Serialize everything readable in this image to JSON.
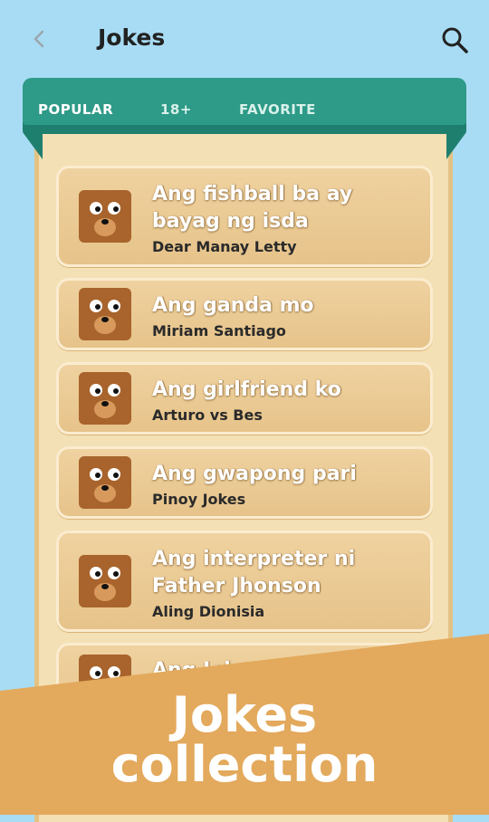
{
  "app_bar": {
    "title": "Jokes",
    "back_icon": "chevron-left-icon",
    "search_icon": "search-icon"
  },
  "tabs": [
    {
      "label": "POPULAR",
      "active": true
    },
    {
      "label": "18+",
      "active": false
    },
    {
      "label": "FAVORITE",
      "active": false
    }
  ],
  "jokes": [
    {
      "title": "Ang fishball ba ay bayag ng isda",
      "author": "Dear Manay Letty",
      "icon": "bear-face-icon"
    },
    {
      "title": "Ang ganda mo",
      "author": "Miriam Santiago",
      "icon": "bear-face-icon"
    },
    {
      "title": "Ang girlfriend ko",
      "author": "Arturo vs Bes",
      "icon": "bear-face-icon"
    },
    {
      "title": "Ang gwapong pari",
      "author": "Pinoy Jokes",
      "icon": "bear-face-icon"
    },
    {
      "title": "Ang interpreter ni Father Jhonson",
      "author": "Aling Dionisia",
      "icon": "bear-face-icon"
    },
    {
      "title": "Ang Jokes",
      "author": "",
      "icon": "bear-face-icon"
    }
  ],
  "banner": {
    "line1": "Jokes",
    "line2": "collection"
  },
  "colors": {
    "background": "#a8dcf4",
    "tab_bar": "#2e9a88",
    "parchment": "#f3e0b4",
    "card": "#e6c38a",
    "banner": "#e3a95c"
  }
}
